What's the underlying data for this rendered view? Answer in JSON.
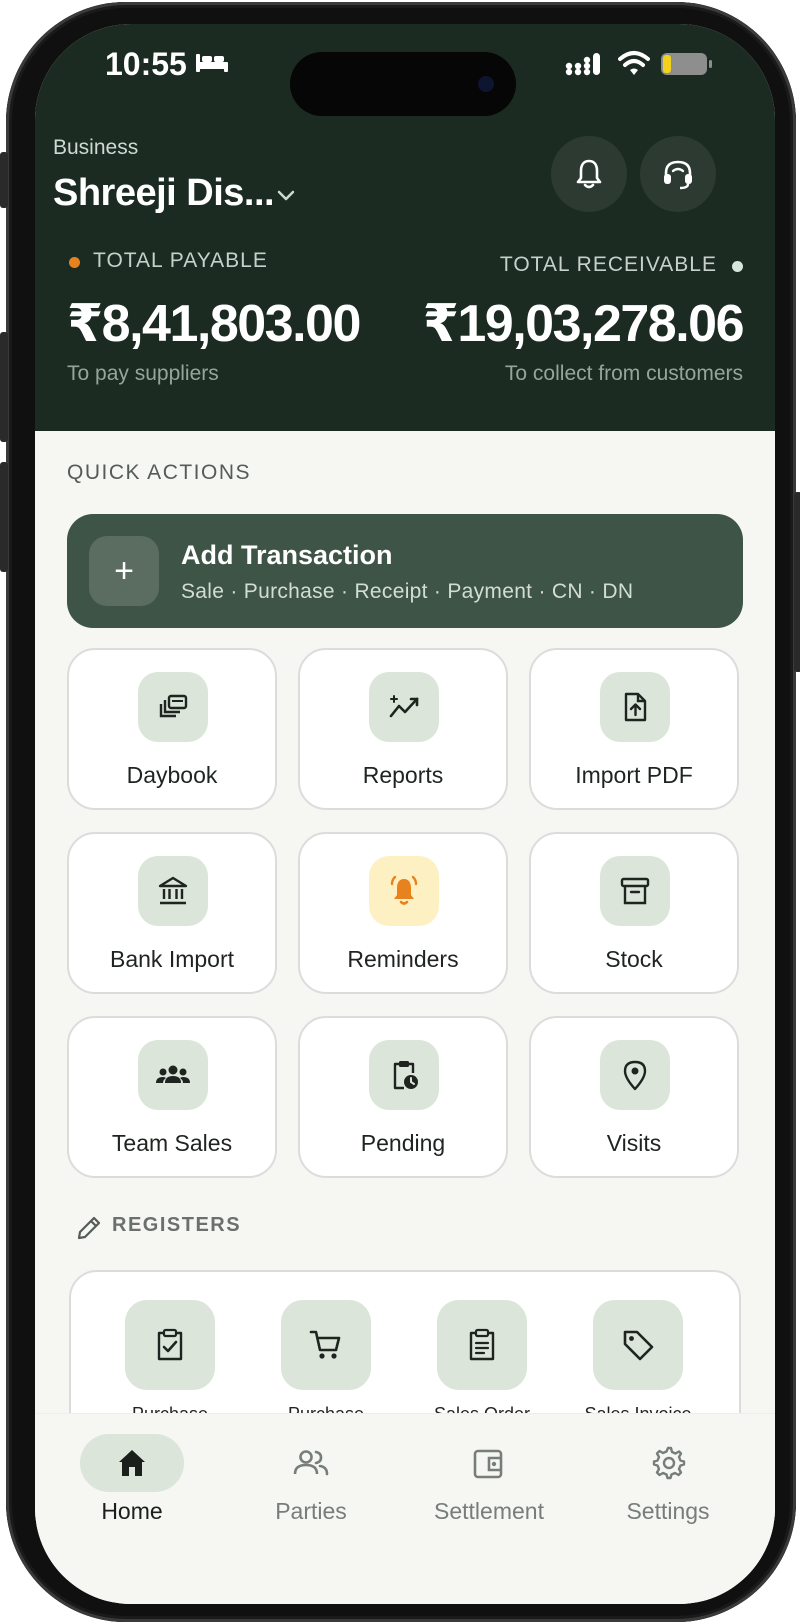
{
  "status_bar": {
    "time": "10:55"
  },
  "header": {
    "business_label": "Business",
    "business_name": "Shreeji Dis...",
    "total_payable": {
      "title": "TOTAL PAYABLE",
      "amount": "₹8,41,803.00",
      "subtitle": "To pay suppliers"
    },
    "total_receivable": {
      "title": "TOTAL RECEIVABLE",
      "amount": "₹19,03,278.06",
      "subtitle": "To collect from customers"
    }
  },
  "quick_actions": {
    "title": "QUICK ACTIONS",
    "add_transaction": {
      "title": "Add Transaction",
      "subtitle": "Sale · Purchase · Receipt · Payment · CN · DN"
    },
    "tiles": [
      {
        "label": "Daybook",
        "icon": "daybook-icon"
      },
      {
        "label": "Reports",
        "icon": "trend-chart-icon"
      },
      {
        "label": "Import PDF",
        "icon": "file-upload-icon"
      },
      {
        "label": "Bank Import",
        "icon": "bank-icon"
      },
      {
        "label": "Reminders",
        "icon": "bell-ring-icon"
      },
      {
        "label": "Stock",
        "icon": "archive-box-icon"
      },
      {
        "label": "Team Sales",
        "icon": "team-icon"
      },
      {
        "label": "Pending",
        "icon": "clipboard-clock-icon"
      },
      {
        "label": "Visits",
        "icon": "location-pin-icon"
      }
    ]
  },
  "registers": {
    "title": "REGISTERS",
    "items": [
      {
        "label": "Purchase",
        "icon": "clipboard-check-icon"
      },
      {
        "label": "Purchase",
        "icon": "cart-icon"
      },
      {
        "label": "Sales Order",
        "icon": "clipboard-list-icon"
      },
      {
        "label": "Sales Invoice",
        "icon": "tag-icon"
      }
    ]
  },
  "bottom_nav": {
    "items": [
      {
        "label": "Home",
        "icon": "home-icon",
        "active": true
      },
      {
        "label": "Parties",
        "icon": "people-icon",
        "active": false
      },
      {
        "label": "Settlement",
        "icon": "wallet-icon",
        "active": false
      },
      {
        "label": "Settings",
        "icon": "gear-icon",
        "active": false
      }
    ]
  },
  "colors": {
    "header_bg": "#1b2b22",
    "primary_card": "#3e5446",
    "icon_tint_bg": "#dbe5d9",
    "warning_tint_bg": "#fdf1c4",
    "warning_icon": "#e8821f",
    "screen_bg": "#f6f6f3"
  }
}
